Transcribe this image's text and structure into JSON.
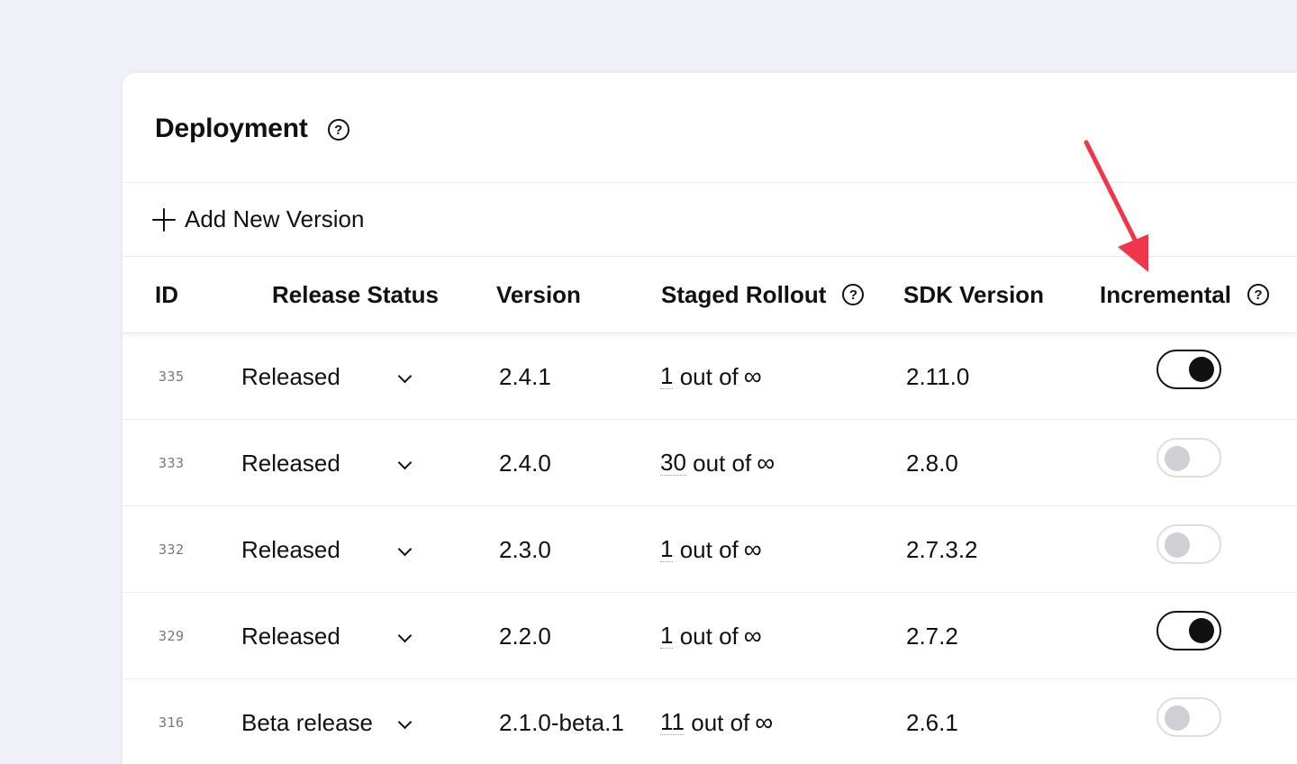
{
  "header": {
    "title": "Deployment"
  },
  "add_button": {
    "label": "Add New Version"
  },
  "columns": {
    "id": "ID",
    "release_status": "Release Status",
    "version": "Version",
    "staged_rollout": "Staged Rollout",
    "sdk_version": "SDK Version",
    "incremental": "Incremental"
  },
  "rows": [
    {
      "id": "335",
      "status": "Released",
      "version": "2.4.1",
      "rollout_count": "1",
      "rollout_suffix": "out of",
      "rollout_total": "∞",
      "sdk": "2.11.0",
      "incremental": true
    },
    {
      "id": "333",
      "status": "Released",
      "version": "2.4.0",
      "rollout_count": "30",
      "rollout_suffix": "out of",
      "rollout_total": "∞",
      "sdk": "2.8.0",
      "incremental": false
    },
    {
      "id": "332",
      "status": "Released",
      "version": "2.3.0",
      "rollout_count": "1",
      "rollout_suffix": "out of",
      "rollout_total": "∞",
      "sdk": "2.7.3.2",
      "incremental": false
    },
    {
      "id": "329",
      "status": "Released",
      "version": "2.2.0",
      "rollout_count": "1",
      "rollout_suffix": "out of",
      "rollout_total": "∞",
      "sdk": "2.7.2",
      "incremental": true
    },
    {
      "id": "316",
      "status": "Beta release",
      "version": "2.1.0-beta.1",
      "rollout_count": "11",
      "rollout_suffix": "out of",
      "rollout_total": "∞",
      "sdk": "2.6.1",
      "incremental": false
    }
  ],
  "icons": {
    "help": "help-circle-icon",
    "add": "plus-icon",
    "dropdown": "chevron-down-icon",
    "annotation": "arrow-down-icon"
  },
  "colors": {
    "background": "#f0f0f8",
    "toggle_on": "#111111",
    "toggle_off_knob": "#cfcfd4",
    "annotation_arrow": "#f0364a"
  }
}
